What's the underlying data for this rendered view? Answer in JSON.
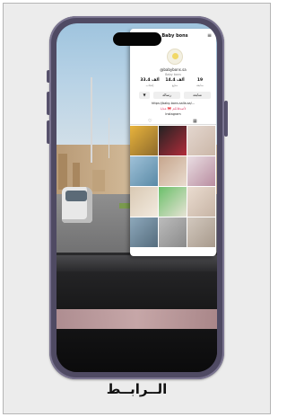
{
  "caption": "الــرابــط",
  "profile": {
    "display_name": "Baby bons",
    "handle": "@babybons.sa",
    "subtitle": "Baby bons",
    "stats": [
      {
        "value": "19",
        "label": "متابعة"
      },
      {
        "value": "14.4 ألف",
        "label": "متابِع"
      },
      {
        "value": "33.4 ألف",
        "label": "إعجاب"
      }
    ],
    "buttons": [
      "متابعة",
      "رسالة",
      "▼"
    ],
    "link": "https://baby-bons.salla.sa/...",
    "bio": "لأصدقائكم 🎀 هدايا",
    "instagram": "Instagram",
    "tab_grid_icon": "grid-icon",
    "tab_liked_icon": "heart-icon"
  },
  "colors": {
    "frame_bg": "#ececec",
    "phone_body": "#4f4a63",
    "accent_pink": "#e0436e"
  }
}
